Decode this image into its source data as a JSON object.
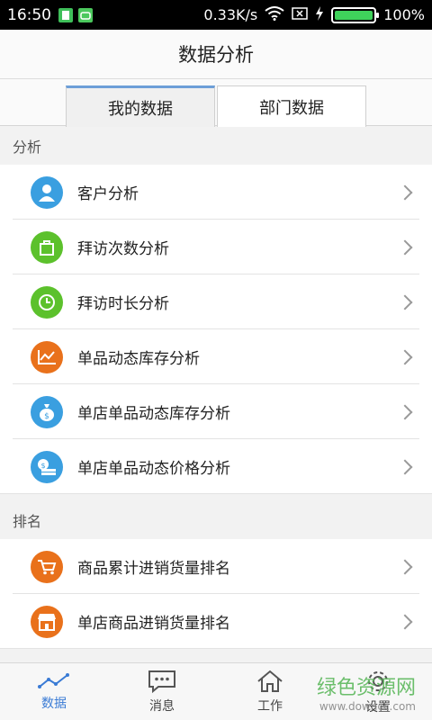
{
  "status_bar": {
    "time": "16:50",
    "speed": "0.33K/s",
    "battery": "100%"
  },
  "header": {
    "title": "数据分析"
  },
  "tabs": [
    {
      "label": "我的数据"
    },
    {
      "label": "部门数据"
    }
  ],
  "sections": [
    {
      "title": "分析",
      "items": [
        {
          "label": "客户分析",
          "icon": "user-icon",
          "color": "#3a9fe0"
        },
        {
          "label": "拜访次数分析",
          "icon": "bag-icon",
          "color": "#5cc12c"
        },
        {
          "label": "拜访时长分析",
          "icon": "clock-icon",
          "color": "#5cc12c"
        },
        {
          "label": "单品动态库存分析",
          "icon": "chart-line-icon",
          "color": "#e9711b"
        },
        {
          "label": "单店单品动态库存分析",
          "icon": "money-bag-icon",
          "color": "#3a9fe0"
        },
        {
          "label": "单店单品动态价格分析",
          "icon": "cash-icon",
          "color": "#3a9fe0"
        }
      ]
    },
    {
      "title": "排名",
      "items": [
        {
          "label": "商品累计进销货量排名",
          "icon": "cart-icon",
          "color": "#e9711b"
        },
        {
          "label": "单店商品进销货量排名",
          "icon": "store-icon",
          "color": "#e9711b"
        }
      ]
    }
  ],
  "bottom_nav": [
    {
      "label": "数据",
      "icon": "chart-icon",
      "active": true
    },
    {
      "label": "消息",
      "icon": "message-icon",
      "active": false
    },
    {
      "label": "工作",
      "icon": "home-icon",
      "active": false
    },
    {
      "label": "设置",
      "icon": "gear-icon",
      "active": false
    }
  ],
  "watermark": {
    "text": "绿色资源网",
    "site": "www.downcc.com"
  }
}
